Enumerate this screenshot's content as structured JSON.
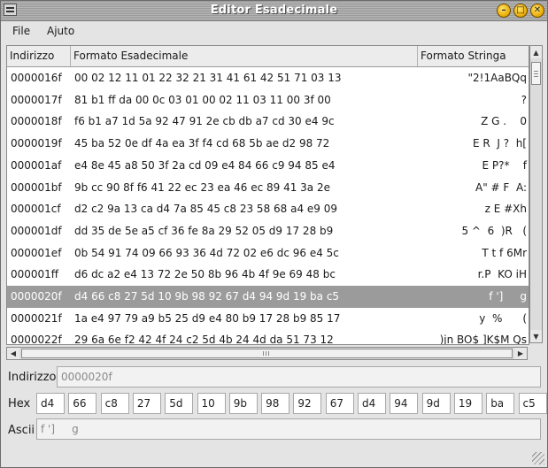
{
  "window": {
    "title": "Editor Esadecimale"
  },
  "menu": {
    "file": "File",
    "help": "Ajuto"
  },
  "table": {
    "columns": {
      "address": "Indirizzo",
      "hex": "Formato Esadecimale",
      "string": "Formato Stringa"
    },
    "rows": [
      {
        "addr": "0000016f",
        "hex": "00 02 12 11 01 22 32 21 31 41 61 42 51 71 03 13",
        "str": "\"2!1AaBQq"
      },
      {
        "addr": "0000017f",
        "hex": "81 b1 ff da 00 0c 03 01 00 02 11 03 11 00 3f 00",
        "str": "?"
      },
      {
        "addr": "0000018f",
        "hex": "f6 b1 a7 1d 5a 92 47 91 2e cb db a7 cd 30 e4 9c",
        "str": "Z G .    0"
      },
      {
        "addr": "0000019f",
        "hex": "45 ba 52 0e df 4a ea 3f f4 cd 68 5b ae d2 98 72",
        "str": "E R  J ?  h["
      },
      {
        "addr": "000001af",
        "hex": "e4 8e 45 a8 50 3f 2a cd 09 e4 84 66 c9 94 85 e4",
        "str": "E P?*    f"
      },
      {
        "addr": "000001bf",
        "hex": "9b cc 90 8f f6 41 22 ec 23 ea 46 ec 89 41 3a 2e",
        "str": "A\" # F  A:"
      },
      {
        "addr": "000001cf",
        "hex": "d2 c2 9a 13 ca d4 7a 85 45 c8 23 58 68 a4 e9 09",
        "str": "z E #Xh"
      },
      {
        "addr": "000001df",
        "hex": "dd 35 de 5e a5 cf 36 fe 8a 29 52 05 d9 17 28 b9",
        "str": "5 ^  6  )R   ("
      },
      {
        "addr": "000001ef",
        "hex": "0b 54 91 74 09 66 93 36 4d 72 02 e6 dc 96 e4 5c",
        "str": "T t f 6Mr"
      },
      {
        "addr": "000001ff",
        "hex": "d6 dc a2 e4 13 72 2e 50 8b 96 4b 4f 9e 69 48 bc",
        "str": "r.P  KO iH"
      },
      {
        "addr": "0000020f",
        "hex": "d4 66 c8 27 5d 10 9b 98 92 67 d4 94 9d 19 ba c5",
        "str": "f ']     g",
        "selected": true
      },
      {
        "addr": "0000021f",
        "hex": "1a e4 97 79 a9 b5 25 d9 e4 80 b9 17 28 b9 85 17",
        "str": "y  %      ("
      },
      {
        "addr": "0000022f",
        "hex": "29 6a 6e f2 42 4f 24 c2 5d 4b 24 4d da 51 73 12",
        "str": ")jn BO$ ]K$M Qs"
      }
    ]
  },
  "details": {
    "address_label": "Indirizzo",
    "address_value": "0000020f",
    "hex_label": "Hex",
    "hex_values": [
      "d4",
      "66",
      "c8",
      "27",
      "5d",
      "10",
      "9b",
      "98",
      "92",
      "67",
      "d4",
      "94",
      "9d",
      "19",
      "ba",
      "c5"
    ],
    "ascii_label": "Ascii",
    "ascii_value": "f ']     g"
  },
  "colors": {
    "selection": "#9b9b9b",
    "title_buttons": "#e8a800"
  },
  "icons": {
    "window_menu": "window-menu-icon",
    "minimize": "minimize-icon",
    "maximize": "maximize-icon",
    "close": "close-icon",
    "resize": "resize-grip-icon"
  }
}
